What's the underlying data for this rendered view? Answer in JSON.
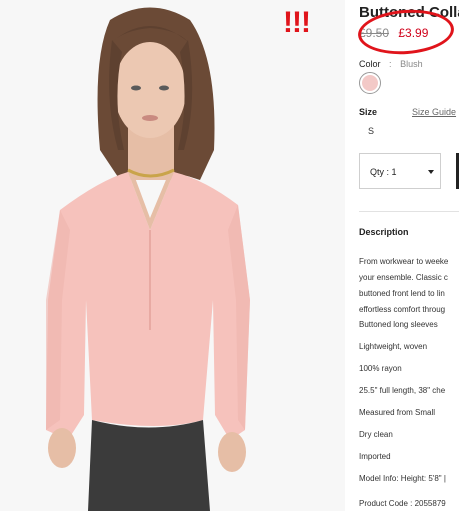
{
  "annotation": {
    "marks": "!!!"
  },
  "product": {
    "title": "Buttoned Colla",
    "old_price": "£9.50",
    "sale_price": "£3.99",
    "color_label": "Color",
    "color_sep": ":",
    "color_value": "Blush",
    "swatch_color": "#f3c9c7",
    "size_label": "Size",
    "size_guide": "Size Guide",
    "size_option": "S",
    "qty_label": "Qty : 1",
    "description_title": "Description",
    "description_lines": [
      "From workwear to weeke",
      "your ensemble. Classic c",
      "buttoned front lend to lin",
      "effortless comfort throug"
    ],
    "details": [
      "Buttoned long sleeves",
      "Lightweight, woven",
      "100% rayon",
      "25.5\" full length, 38\" che",
      "Measured from Small",
      "Dry clean",
      "Imported",
      "Model Info: Height: 5'8\" |"
    ],
    "product_code": "Product Code : 2055879"
  },
  "colors": {
    "sale": "#d0021b",
    "annotation": "#e0141b",
    "blouse": "#f6c2bc",
    "skin": "#e9c4ae",
    "hair": "#6b4a36",
    "pants": "#3b3b3b"
  }
}
